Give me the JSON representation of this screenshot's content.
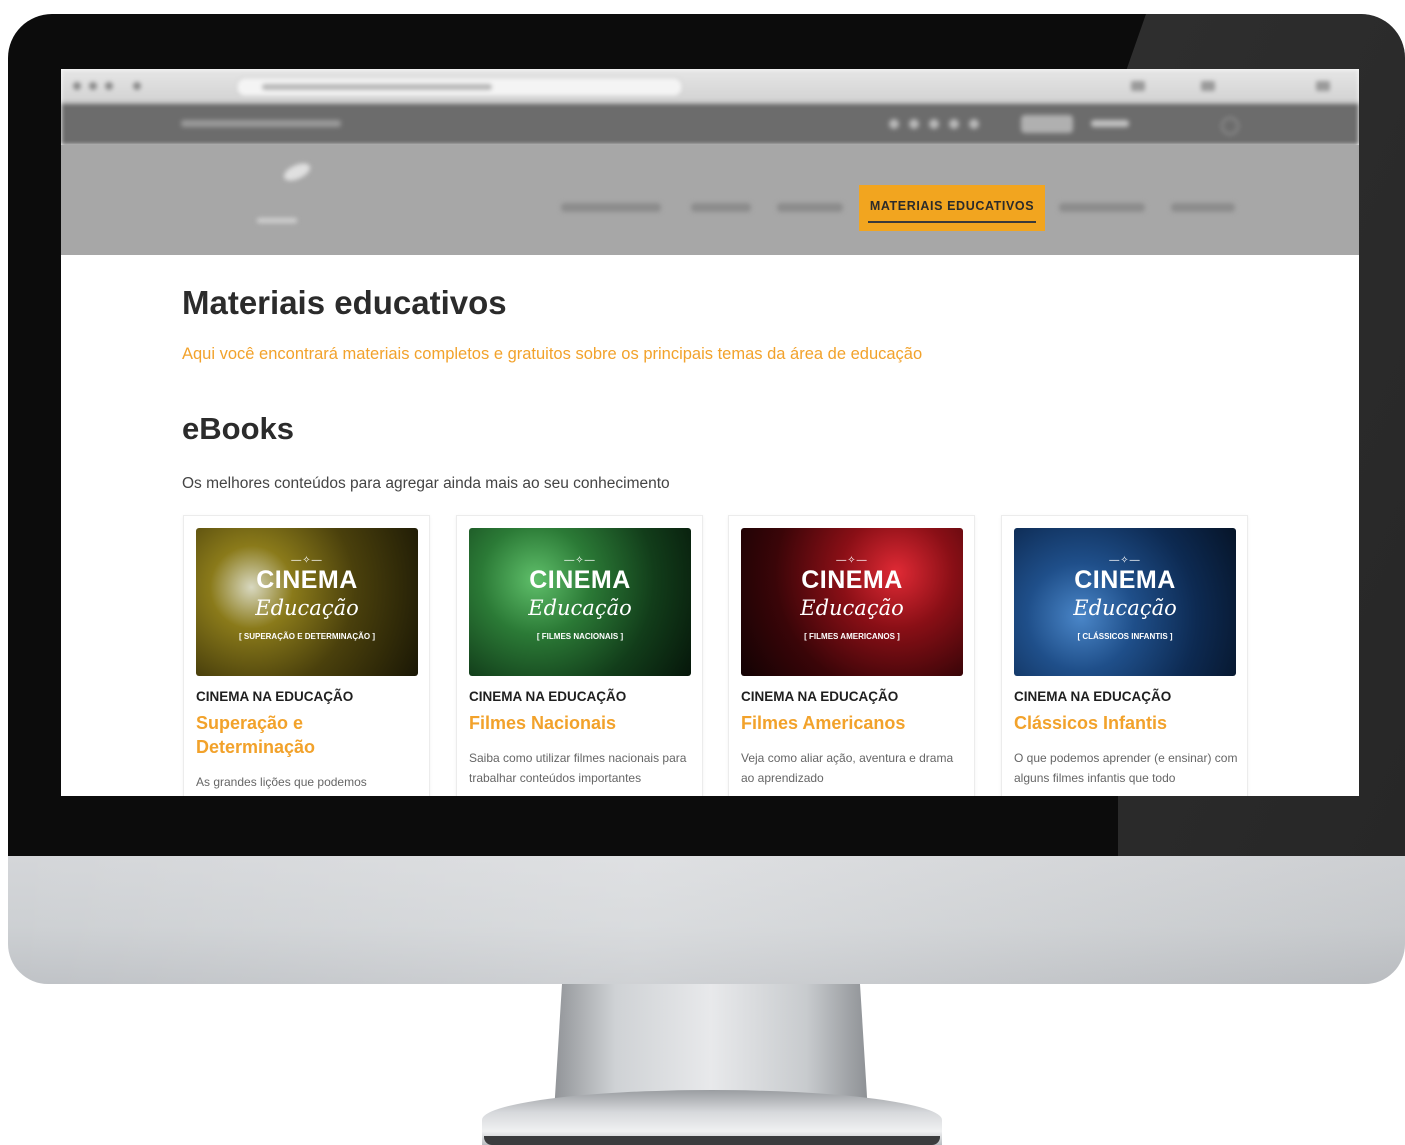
{
  "nav": {
    "active_label": "MATERIAIS EDUCATIVOS"
  },
  "page": {
    "title": "Materiais educativos",
    "subtitle": "Aqui você encontrará materiais completos e gratuitos sobre os principais temas da área de educação"
  },
  "ebooks": {
    "title": "eBooks",
    "subtitle": "Os melhores conteúdos para agregar ainda mais ao seu conhecimento",
    "cards": [
      {
        "cover_title": "CINEMA",
        "cover_script": "Educação",
        "cover_subtitle": "[ SUPERAÇÃO E DETERMINAÇÃO ]",
        "kicker": "CINEMA NA EDUCAÇÃO",
        "title": "Superação e Determinação",
        "description": "As grandes lições que podemos",
        "cover_color": "#5a4e10"
      },
      {
        "cover_title": "CINEMA",
        "cover_script": "Educação",
        "cover_subtitle": "[ FILMES NACIONAIS ]",
        "kicker": "CINEMA NA EDUCAÇÃO",
        "title": "Filmes Nacionais",
        "description": "Saiba como utilizar filmes nacionais para trabalhar conteúdos importantes",
        "cover_color": "#1f5a2a"
      },
      {
        "cover_title": "CINEMA",
        "cover_script": "Educação",
        "cover_subtitle": "[ FILMES AMERICANOS ]",
        "kicker": "CINEMA NA EDUCAÇÃO",
        "title": "Filmes Americanos",
        "description": "Veja como aliar ação, aventura e drama ao aprendizado",
        "cover_color": "#6a0d12"
      },
      {
        "cover_title": "CINEMA",
        "cover_script": "Educação",
        "cover_subtitle": "[ CLÁSSICOS INFANTIS ]",
        "kicker": "CINEMA NA EDUCAÇÃO",
        "title": "Clássicos Infantis",
        "description": "O que podemos aprender (e ensinar) com alguns filmes infantis que todo",
        "cover_color": "#123a6a"
      }
    ]
  },
  "colors": {
    "accent": "#f2a51f",
    "accent_text": "#f2a22b",
    "heading": "#2b2b2b",
    "nav_bg": "#a7a7a7"
  }
}
